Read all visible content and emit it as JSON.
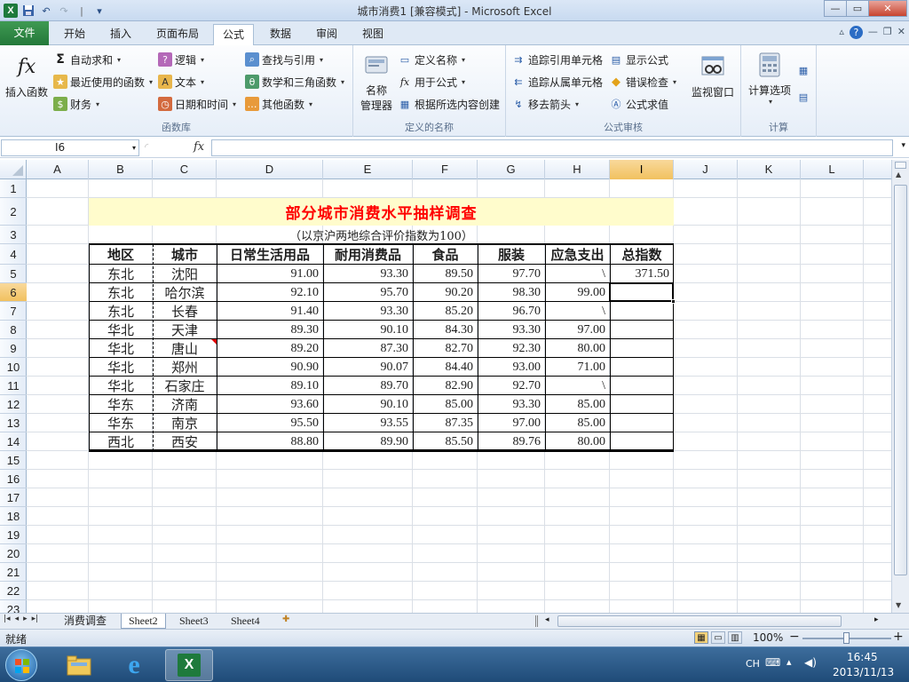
{
  "window": {
    "title": "城市消费1  [兼容模式] - Microsoft Excel",
    "qat_separator": "|",
    "qat_more": "▾",
    "logo": "X",
    "min_btn": "—",
    "max_btn": "▭",
    "close_btn": "✕"
  },
  "tabs": {
    "file": "文件",
    "items": [
      "开始",
      "插入",
      "页面布局",
      "公式",
      "数据",
      "审阅",
      "视图"
    ],
    "active": "公式",
    "right_icons": [
      "▵",
      "?",
      "—",
      "❐",
      "✕"
    ]
  },
  "ribbon": {
    "function_library": {
      "label": "函数库",
      "insert_function": "插入函数",
      "insert_function_icon": "fx",
      "autosum": "自动求和",
      "recent": "最近使用的函数",
      "financial": "财务",
      "logical": "逻辑",
      "text": "文本",
      "datetime": "日期和时间",
      "lookup": "查找与引用",
      "math": "数学和三角函数",
      "more": "其他函数"
    },
    "defined_names": {
      "label": "定义的名称",
      "name_manager_line1": "名称",
      "name_manager_line2": "管理器",
      "define_name": "定义名称",
      "use_in_formula": "用于公式",
      "create_from_selection": "根据所选内容创建"
    },
    "formula_auditing": {
      "label": "公式审核",
      "trace_precedents": "追踪引用单元格",
      "trace_dependents": "追踪从属单元格",
      "remove_arrows": "移去箭头",
      "show_formulas": "显示公式",
      "error_checking": "错误检查",
      "evaluate_formula": "公式求值",
      "watch_window": "监视窗口"
    },
    "calculation": {
      "label": "计算",
      "calc_options": "计算选项"
    }
  },
  "formula_bar": {
    "name_box": "I6",
    "fx_label": "fx",
    "value": ""
  },
  "columns": [
    "A",
    "B",
    "C",
    "D",
    "E",
    "F",
    "G",
    "H",
    "I",
    "J",
    "K",
    "L"
  ],
  "selected_column": "I",
  "rows": [
    "1",
    "2",
    "3",
    "4",
    "5",
    "6",
    "7",
    "8",
    "9",
    "10",
    "11",
    "12",
    "13",
    "14",
    "15",
    "16",
    "17",
    "18",
    "19",
    "20",
    "21",
    "22",
    "23"
  ],
  "selected_row": "6",
  "sheet": {
    "title": "部分城市消费水平抽样调查",
    "subtitle": "（以京沪两地综合评价指数为100）",
    "headers": [
      "地区",
      "城市",
      "日常生活用品",
      "耐用消费品",
      "食品",
      "服装",
      "应急支出",
      "总指数"
    ],
    "rows": [
      [
        "东北",
        "沈阳",
        "91.00",
        "93.30",
        "89.50",
        "97.70",
        "\\",
        "371.50"
      ],
      [
        "东北",
        "哈尔滨",
        "92.10",
        "95.70",
        "90.20",
        "98.30",
        "99.00",
        ""
      ],
      [
        "东北",
        "长春",
        "91.40",
        "93.30",
        "85.20",
        "96.70",
        "\\",
        ""
      ],
      [
        "华北",
        "天津",
        "89.30",
        "90.10",
        "84.30",
        "93.30",
        "97.00",
        ""
      ],
      [
        "华北",
        "唐山",
        "89.20",
        "87.30",
        "82.70",
        "92.30",
        "80.00",
        ""
      ],
      [
        "华北",
        "郑州",
        "90.90",
        "90.07",
        "84.40",
        "93.00",
        "71.00",
        ""
      ],
      [
        "华北",
        "石家庄",
        "89.10",
        "89.70",
        "82.90",
        "92.70",
        "\\",
        ""
      ],
      [
        "华东",
        "济南",
        "93.60",
        "90.10",
        "85.00",
        "93.30",
        "85.00",
        ""
      ],
      [
        "华东",
        "南京",
        "95.50",
        "93.55",
        "87.35",
        "97.00",
        "85.00",
        ""
      ],
      [
        "西北",
        "西安",
        "88.80",
        "89.90",
        "85.50",
        "89.76",
        "80.00",
        ""
      ]
    ]
  },
  "sheet_tabs": {
    "nav": [
      "|◂",
      "◂",
      "▸",
      "▸|"
    ],
    "items": [
      "消费调查",
      "Sheet2",
      "Sheet3",
      "Sheet4"
    ],
    "active": "Sheet2"
  },
  "statusbar": {
    "ready": "就绪",
    "zoom": "100%",
    "zoom_minus": "−",
    "zoom_plus": "+"
  },
  "taskbar": {
    "lang": "CH",
    "time": "16:45",
    "date": "2013/11/13"
  },
  "colors": {
    "accent": "#217346",
    "title_red": "#ff0000",
    "title_band": "#fffccc",
    "selected_header": "#f1c15f"
  }
}
